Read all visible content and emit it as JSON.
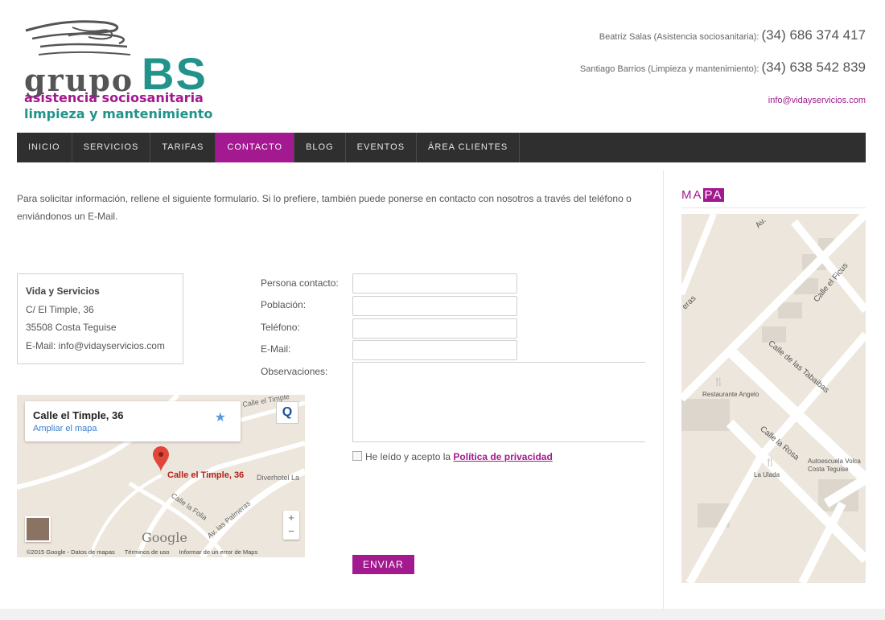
{
  "logo": {
    "grupo": "grupo",
    "bs": "BS",
    "line1": "asistencia sociosanitaria",
    "line2": "limpieza y mantenimiento",
    "colors": {
      "magenta": "#a3198f",
      "teal": "#21938a"
    }
  },
  "header": {
    "contact1_name": "Beatriz Salas (Asistencia sociosanitaria):",
    "contact1_phone": "(34) 686 374 417",
    "contact2_name": "Santiago Barrios (Limpieza y mantenimiento):",
    "contact2_phone": "(34) 638 542 839",
    "email": "info@vidayservicios.com"
  },
  "nav": {
    "items": [
      {
        "label": "INICIO"
      },
      {
        "label": "SERVICIOS"
      },
      {
        "label": "TARIFAS"
      },
      {
        "label": "CONTACTO",
        "active": true
      },
      {
        "label": "BLOG"
      },
      {
        "label": "EVENTOS"
      },
      {
        "label": "ÁREA CLIENTES"
      }
    ]
  },
  "intro": "Para solicitar información, rellene el siguiente formulario. Si lo prefiere, también puede ponerse en contacto con nosotros  a través del teléfono o enviándonos un E-Mail.",
  "address": {
    "name": "Vida y Servicios",
    "street": "C/ El Timple, 36",
    "city": "35508 Costa Teguise",
    "email": "E-Mail: info@vidayservicios.com"
  },
  "smallmap": {
    "place_title": "Calle el Timple, 36",
    "enlarge_link": "Ampliar el mapa",
    "pin_label": "Calle el Timple, 36",
    "hotel": "Diverhotel La",
    "street_a": "Calle el Timple",
    "street_b": "Calle la Folia",
    "street_c": "Av. las Palmeras",
    "google": "Google",
    "footer_copy": "©2015 Google - Datos de mapas",
    "footer_terms": "Términos de uso",
    "footer_report": "Informar de un error de Maps",
    "zoom_in": "+",
    "zoom_out": "−"
  },
  "form": {
    "labels": {
      "contact": "Persona contacto:",
      "city": "Población:",
      "phone": "Teléfono:",
      "email": "E-Mail:",
      "notes": "Observaciones:"
    },
    "values": {
      "contact": "",
      "city": "",
      "phone": "",
      "email": "",
      "notes": ""
    },
    "privacy_text": "He leído y acepto la ",
    "privacy_link": "Política de privacidad",
    "send": "ENVIAR"
  },
  "sidebar": {
    "title_a": "MA",
    "title_b": "PA",
    "map_labels": {
      "av": "Av.",
      "ficus": "Calle el Ficus",
      "tabaibas": "Calle de las Tabaibas",
      "rosa": "Calle la Rosa",
      "restaurant": "Restaurante Angelo",
      "ulada": "La Ulada",
      "autoescuela1": "Autoescuela Volca",
      "autoescuela2": "Costa Teguise",
      "eras": "eras"
    }
  }
}
